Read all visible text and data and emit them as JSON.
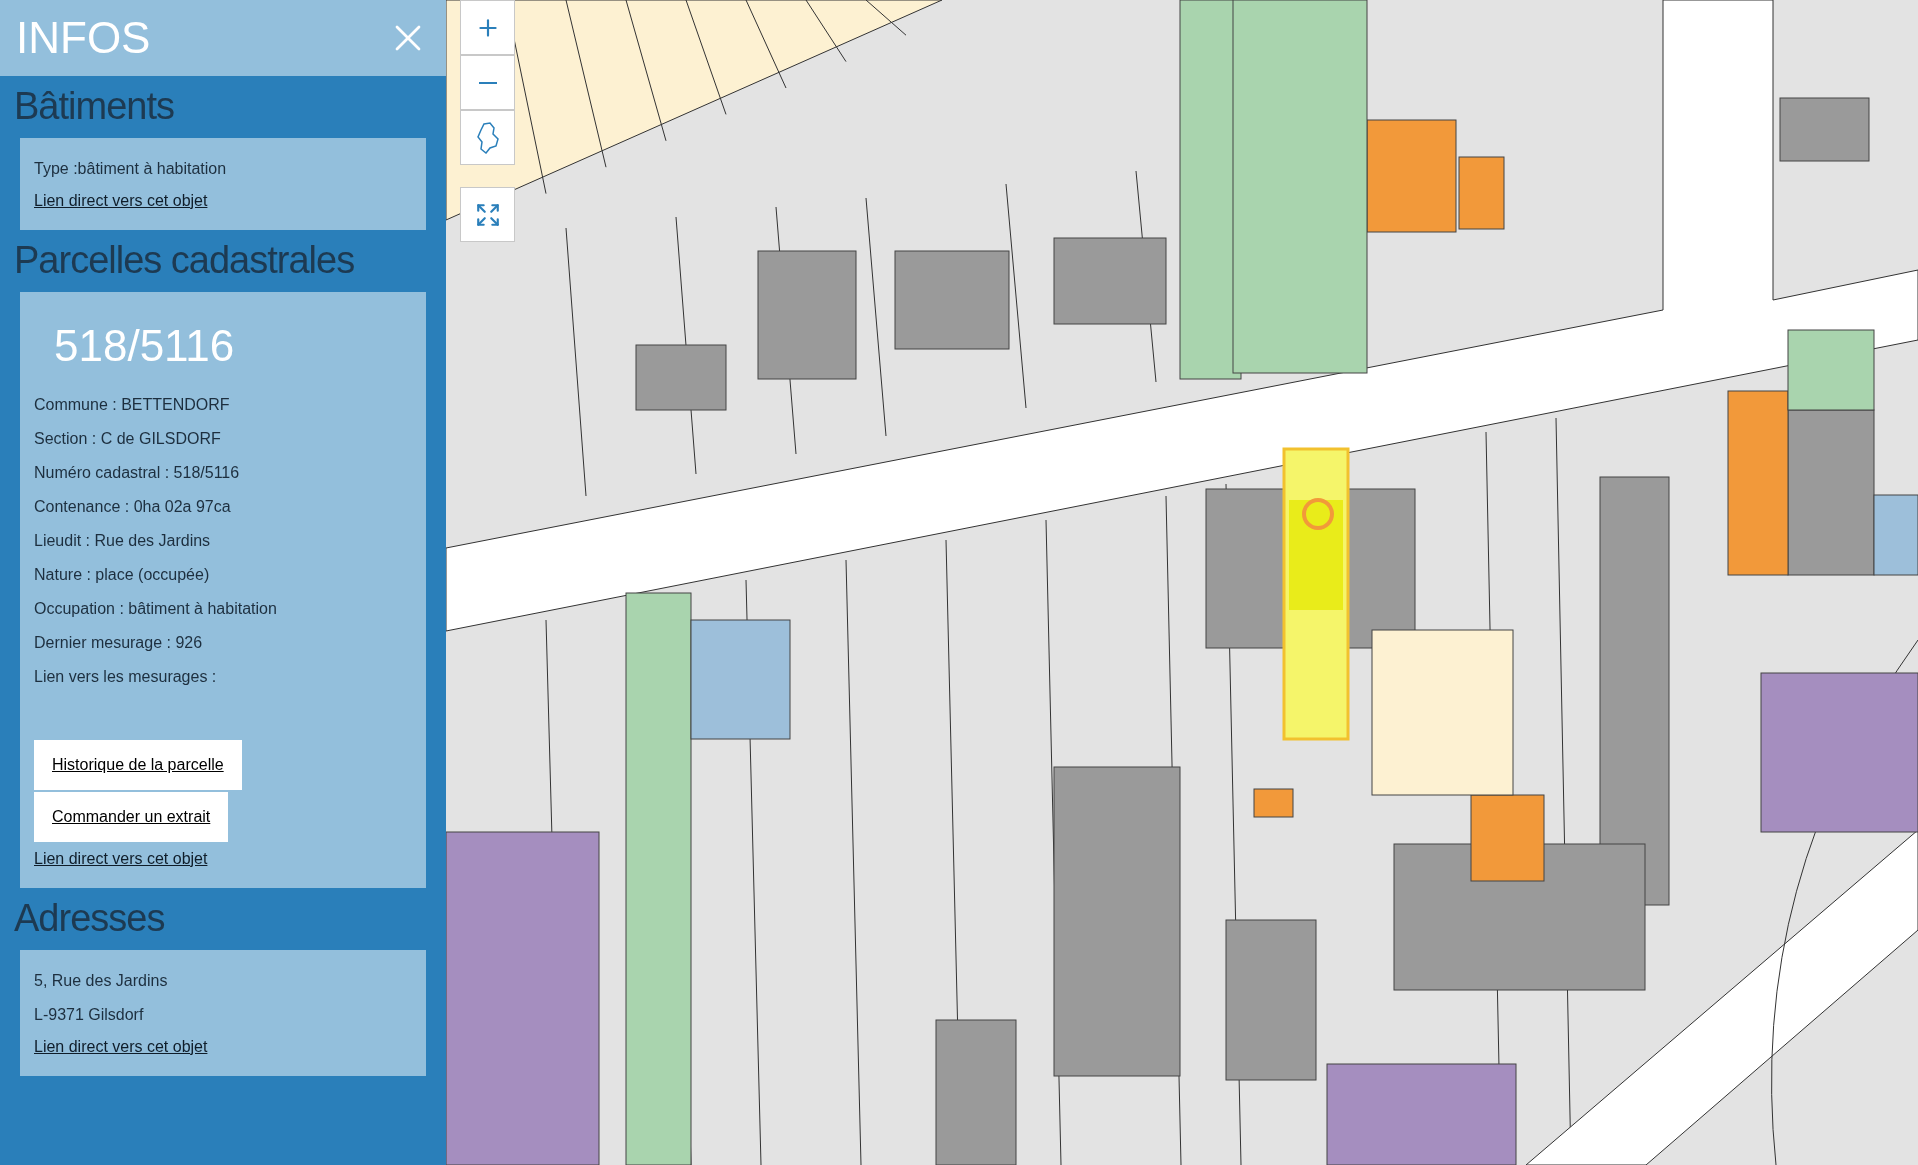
{
  "panel": {
    "title": "INFOS"
  },
  "sections": [
    {
      "heading": "Bâtiments",
      "lines": [
        "Type :bâtiment à habitation"
      ],
      "link": "Lien direct vers cet objet"
    },
    {
      "heading": "Parcelles cadastrales",
      "number": "518/5116",
      "lines": [
        "Commune : BETTENDORF",
        "Section : C de GILSDORF",
        "Numéro cadastral : 518/5116",
        "Contenance : 0ha 02a 97ca",
        "Lieudit : Rue des Jardins",
        "Nature : place (occupée)",
        "Occupation : bâtiment à habitation",
        "Dernier mesurage : 926",
        "Lien vers les mesurages :"
      ],
      "buttons": [
        "Historique de la parcelle",
        "Commander un extrait"
      ],
      "link": "Lien direct vers cet objet"
    },
    {
      "heading": "Adresses",
      "lines": [
        "5, Rue des Jardins",
        "L-9371 Gilsdorf"
      ],
      "link": "Lien direct vers cet objet"
    }
  ]
}
